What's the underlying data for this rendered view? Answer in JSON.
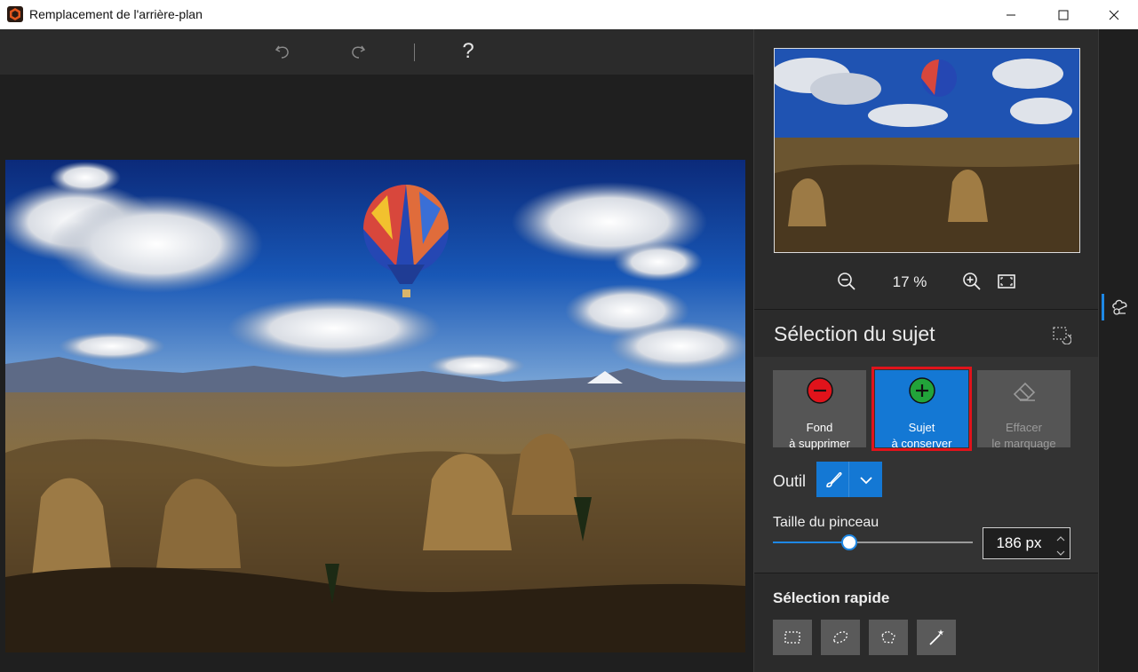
{
  "window": {
    "title": "Remplacement de l'arrière-plan",
    "controls": [
      "minimize-icon",
      "maximize-icon",
      "close-icon"
    ]
  },
  "toolbar": {
    "undo_icon": "undo-icon",
    "redo_icon": "redo-icon",
    "help_label": "?"
  },
  "preview": {
    "zoom_level": "17 %",
    "zoom_out_icon": "zoom-out-icon",
    "zoom_in_icon": "zoom-in-icon",
    "fit_icon": "fit-to-window-icon"
  },
  "subject_selection": {
    "title": "Sélection du sujet",
    "modes": [
      {
        "line1": "Fond",
        "line2": "à supprimer",
        "icon": "minus-circle-icon",
        "color": "#e0131b"
      },
      {
        "line1": "Sujet",
        "line2": "à conserver",
        "icon": "plus-circle-icon",
        "color": "#22a33a",
        "selected": true
      },
      {
        "line1": "Effacer",
        "line2": "le marquage",
        "icon": "eraser-icon",
        "disabled": true
      }
    ],
    "tool_label": "Outil",
    "brush_size_label": "Taille du pinceau",
    "brush_size_value": "186 px",
    "brush_slider_fraction": 0.38
  },
  "quick_selection": {
    "title": "Sélection rapide",
    "tools": [
      "rectangle-select-icon",
      "lasso-icon",
      "polygon-lasso-icon",
      "magic-wand-icon"
    ]
  },
  "colors": {
    "accent": "#1478d4",
    "highlight_border": "#e0131b"
  }
}
